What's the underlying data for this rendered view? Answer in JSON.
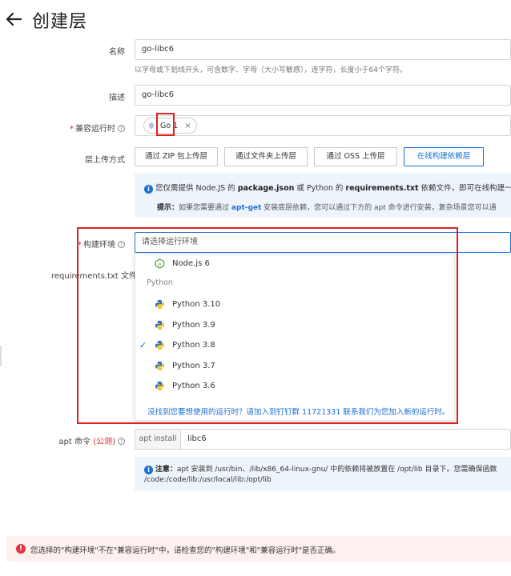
{
  "header": {
    "title": "创建层"
  },
  "form": {
    "name_label": "名称",
    "name_value": "go-libc6",
    "name_help": "以字母或下划线开头，可含数字、字母（大小写敏感），连字符，长度小于64个字符。",
    "desc_label": "描述",
    "desc_value": "go-libc6",
    "compat_required": "*",
    "compat_label": "兼容运行时",
    "compat_tag": "Go 1",
    "compat_tag_close": "×",
    "upload_label": "层上传方式",
    "upload_buttons": [
      "通过 ZIP 包上传层",
      "通过文件夹上传层",
      "通过 OSS 上传层",
      "在线构建依赖层"
    ],
    "info_line1_pre": "您仅需提供 Node.JS 的 ",
    "info_line1_b1": "package.json",
    "info_line1_mid": " 或 Python 的 ",
    "info_line1_b2": "requirements.txt",
    "info_line1_post": " 依赖文件，即可在线构建一个含有",
    "info_line2_b": "提示：",
    "info_line2_pre": "如果您需要通过 ",
    "info_line2_link": "apt-get",
    "info_line2_post": " 安装底层依赖，您可以通过下方的 apt 命令进行安装，复杂场景您可以通",
    "env_required": "*",
    "env_label": "构建环境",
    "env_placeholder": "请选择运行环境",
    "req_label": "requirements.txt 文件",
    "apt_label": "apt 命令",
    "apt_beta": "(公测)",
    "apt_prefix": "apt install",
    "apt_value": "libc6",
    "note_b": "注意：",
    "note_line1": "apt 安装到 /usr/bin、/lib/x86_64-linux-gnu/ 中的依赖将被放置在 /opt/lib 目录下。您需确保函数",
    "note_line2": "/code:/code/lib:/usr/local/lib:/opt/lib"
  },
  "dropdown": {
    "node_option": "Node.js 6",
    "python_group": "Python",
    "python_options": [
      "Python 3.10",
      "Python 3.9",
      "Python 3.8",
      "Python 3.7",
      "Python 3.6"
    ],
    "selected": "Python 3.8",
    "check": "✓",
    "nofind": "没找到您要想使用的运行时？请加入到钉钉群 11721331 联系我们为您加入新的运行时。"
  },
  "error": {
    "icon": "!",
    "message": "您选择的\"构建环境\"不在\"兼容运行时\"中，请检查您的\"构建环境\"和\"兼容运行时\"是否正确。"
  },
  "colors": {
    "accent": "#1a6fd6",
    "highlight": "#e02020",
    "error_bg": "#fdf0ee"
  },
  "icons": [
    "back-arrow-icon",
    "question-icon",
    "info-icon",
    "nodejs-icon",
    "python-icon",
    "error-icon"
  ]
}
